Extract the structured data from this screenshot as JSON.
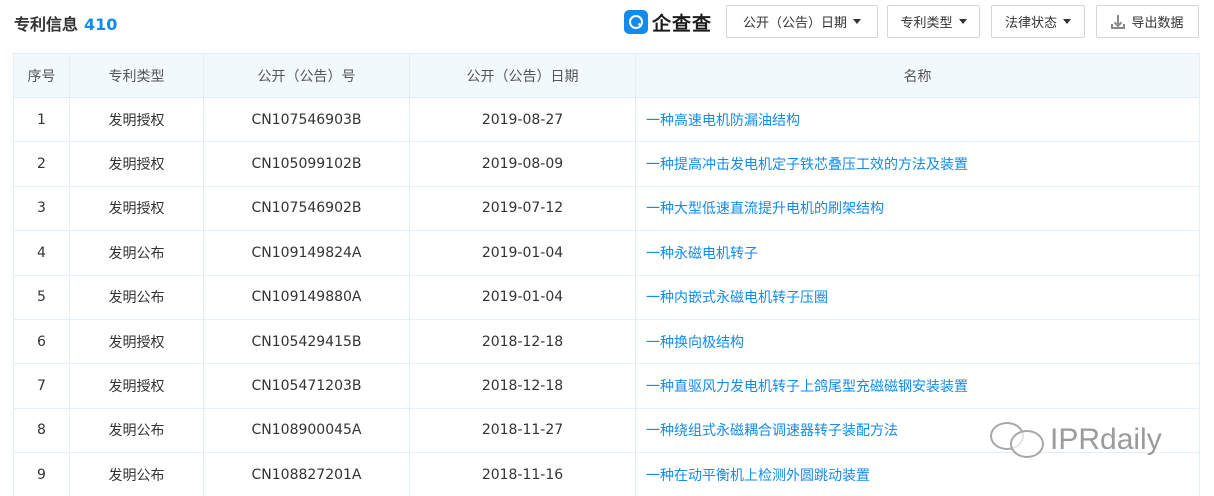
{
  "header": {
    "title": "专利信息",
    "count": "410",
    "logo_text": "企查查",
    "logo_icon": "qichacha-logo-icon",
    "filters": [
      {
        "label": "公开（公告）日期",
        "icon": "caret-down-icon"
      },
      {
        "label": "专利类型",
        "icon": "caret-down-icon"
      },
      {
        "label": "法律状态",
        "icon": "caret-down-icon"
      }
    ],
    "export_label": "导出数据",
    "export_icon": "download-icon"
  },
  "table": {
    "columns": [
      "序号",
      "专利类型",
      "公开（公告）号",
      "公开（公告）日期",
      "名称"
    ],
    "rows": [
      {
        "index": "1",
        "type": "发明授权",
        "number": "CN107546903B",
        "date": "2019-08-27",
        "name": "一种高速电机防漏油结构"
      },
      {
        "index": "2",
        "type": "发明授权",
        "number": "CN105099102B",
        "date": "2019-08-09",
        "name": "一种提高冲击发电机定子铁芯叠压工效的方法及装置"
      },
      {
        "index": "3",
        "type": "发明授权",
        "number": "CN107546902B",
        "date": "2019-07-12",
        "name": "一种大型低速直流提升电机的刷架结构"
      },
      {
        "index": "4",
        "type": "发明公布",
        "number": "CN109149824A",
        "date": "2019-01-04",
        "name": "一种永磁电机转子"
      },
      {
        "index": "5",
        "type": "发明公布",
        "number": "CN109149880A",
        "date": "2019-01-04",
        "name": "一种内嵌式永磁电机转子压圈"
      },
      {
        "index": "6",
        "type": "发明授权",
        "number": "CN105429415B",
        "date": "2018-12-18",
        "name": "一种换向极结构"
      },
      {
        "index": "7",
        "type": "发明授权",
        "number": "CN105471203B",
        "date": "2018-12-18",
        "name": "一种直驱风力发电机转子上鸽尾型充磁磁钢安装装置"
      },
      {
        "index": "8",
        "type": "发明公布",
        "number": "CN108900045A",
        "date": "2018-11-27",
        "name": "一种绕组式永磁耦合调速器转子装配方法"
      },
      {
        "index": "9",
        "type": "发明公布",
        "number": "CN108827201A",
        "date": "2018-11-16",
        "name": "一种在动平衡机上检测外圆跳动装置"
      }
    ]
  },
  "watermark": {
    "text": "IPRdaily",
    "icon": "wechat-icon"
  },
  "colors": {
    "accent": "#128bed",
    "header_bg": "#f2f9fc",
    "border": "#e4eef6"
  }
}
